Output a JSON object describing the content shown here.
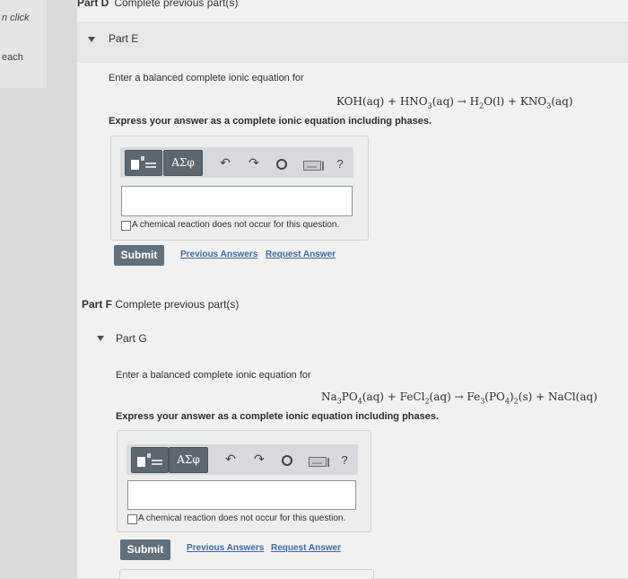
{
  "left_panel": {
    "text1": "n click",
    "text2": "each"
  },
  "top_part": {
    "label": "Part D",
    "status": "Complete previous part(s)"
  },
  "part_e": {
    "title": "Part E",
    "prompt": "Enter a balanced complete ionic equation for",
    "express": "Express your answer as a complete ionic equation including phases.",
    "toolbar_greek": "ΑΣφ",
    "no_reaction_label": "A chemical reaction does not occur for this question.",
    "submit": "Submit",
    "previous_answers": "Previous Answers",
    "request_answer": "Request Answer"
  },
  "part_f": {
    "label": "Part F",
    "status": "Complete previous part(s)"
  },
  "part_g": {
    "title": "Part G",
    "prompt": "Enter a balanced complete ionic equation for",
    "express": "Express your answer as a complete ionic equation including phases.",
    "toolbar_greek": "ΑΣφ",
    "no_reaction_label": "A chemical reaction does not occur for this question.",
    "submit": "Submit",
    "previous_answers": "Previous Answers",
    "request_answer": "Request Answer"
  },
  "toolbar_icons": [
    "templates-icon",
    "greek-symbols-icon",
    "undo-icon",
    "redo-icon",
    "reset-icon",
    "keyboard-icon",
    "help-icon"
  ]
}
